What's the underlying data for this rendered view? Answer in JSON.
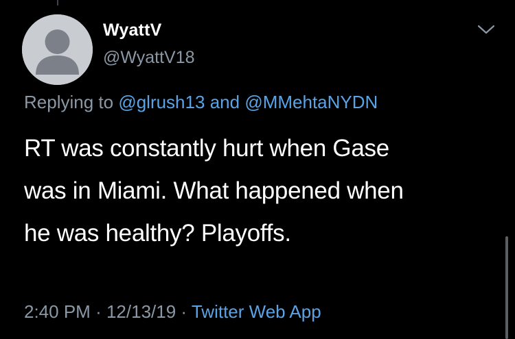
{
  "tweet": {
    "author": {
      "display_name": "WyattV",
      "handle": "@WyattV18",
      "avatar_icon": "default-avatar-icon"
    },
    "replying": {
      "prefix": "Replying to",
      "mention_1": "@glrush13",
      "conjunction": "and",
      "mention_2": "@MMehtaNYDN"
    },
    "text_lines": [
      "RT was constantly hurt when Gase",
      "was in Miami. What happened when",
      "he was healthy? Playoffs."
    ],
    "meta": {
      "time": "2:40 PM",
      "separator": "·",
      "date": "12/13/19",
      "source": "Twitter Web App"
    },
    "menu_icon": "chevron-down-icon"
  },
  "colors": {
    "background": "#000000",
    "primary_text": "#ffffff",
    "secondary_text": "#8b98a5",
    "link": "#5aa3e6"
  }
}
